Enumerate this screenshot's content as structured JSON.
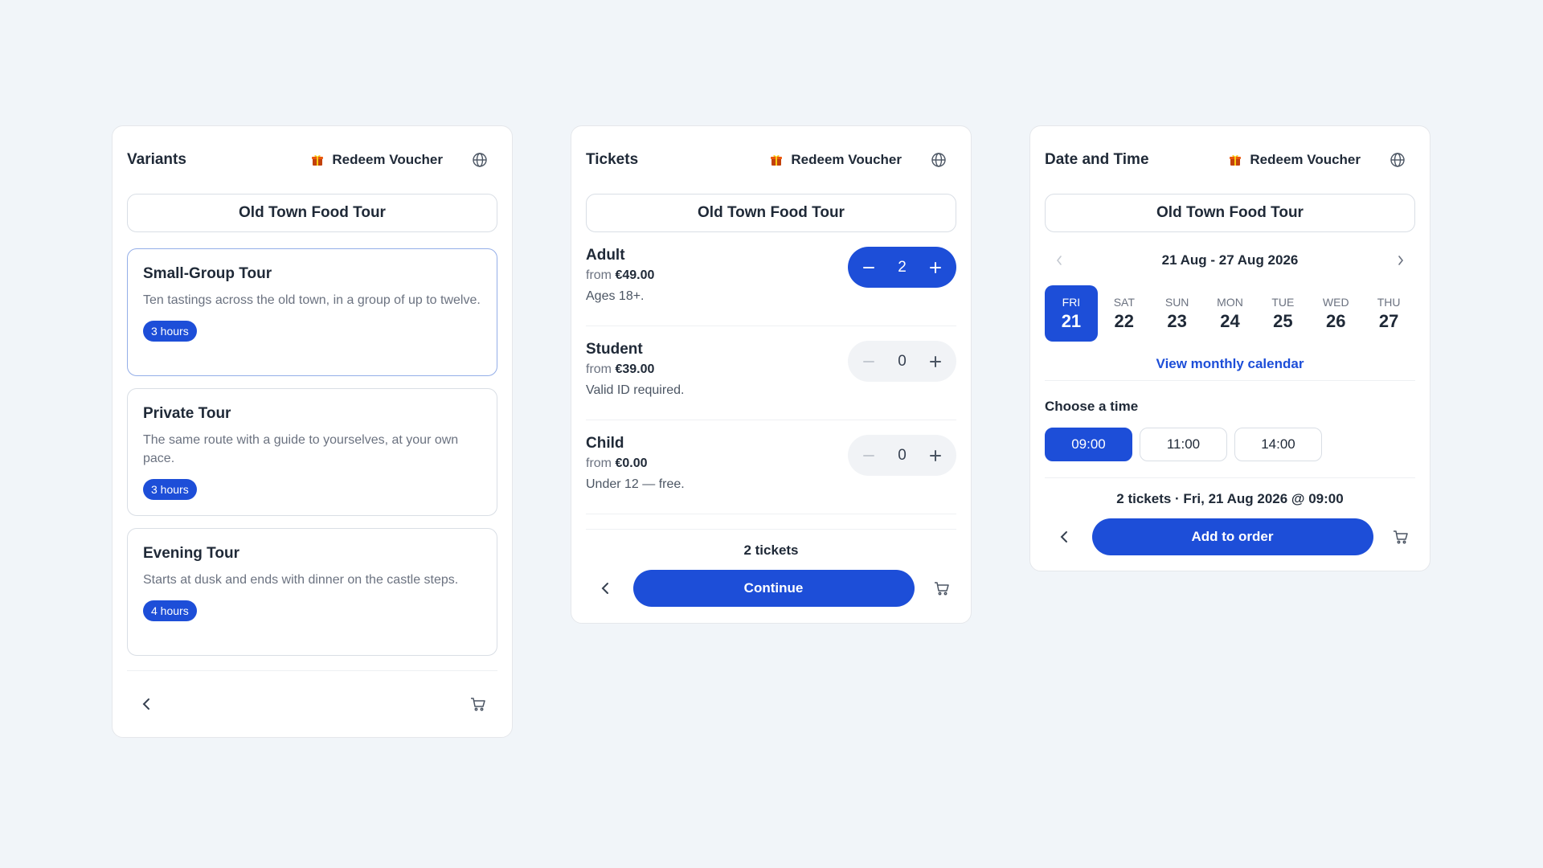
{
  "colors": {
    "accent": "#1d4ed8",
    "background": "#f1f5f9"
  },
  "voucher_label": "Redeem Voucher",
  "product_name": "Old Town Food Tour",
  "variants_panel": {
    "title": "Variants",
    "items": [
      {
        "title": "Small-Group Tour",
        "description": "Ten tastings across the old town, in a group of up to twelve.",
        "duration": "3 hours",
        "selected": true
      },
      {
        "title": "Private Tour",
        "description": "The same route with a guide to yourselves, at your own pace.",
        "duration": "3 hours",
        "selected": false
      },
      {
        "title": "Evening Tour",
        "description": "Starts at dusk and ends with dinner on the castle steps.",
        "duration": "4 hours",
        "selected": false
      }
    ]
  },
  "tickets_panel": {
    "title": "Tickets",
    "rows": [
      {
        "name": "Adult",
        "from_label": "from",
        "price": "€49.00",
        "note": "Ages 18+.",
        "count": "2"
      },
      {
        "name": "Student",
        "from_label": "from",
        "price": "€39.00",
        "note": "Valid ID required.",
        "count": "0"
      },
      {
        "name": "Child",
        "from_label": "from",
        "price": "€0.00",
        "note": "Under 12 — free.",
        "count": "0"
      }
    ],
    "summary": "2 tickets",
    "continue_label": "Continue"
  },
  "date_panel": {
    "title": "Date and Time",
    "week_range": "21 Aug - 27 Aug 2026",
    "days": [
      {
        "name": "FRI",
        "num": "21",
        "selected": true
      },
      {
        "name": "SAT",
        "num": "22"
      },
      {
        "name": "SUN",
        "num": "23"
      },
      {
        "name": "MON",
        "num": "24"
      },
      {
        "name": "TUE",
        "num": "25"
      },
      {
        "name": "WED",
        "num": "26"
      },
      {
        "name": "THU",
        "num": "27"
      }
    ],
    "monthly_link": "View monthly calendar",
    "choose_time_label": "Choose a time",
    "times": [
      {
        "label": "09:00",
        "selected": true
      },
      {
        "label": "11:00"
      },
      {
        "label": "14:00"
      }
    ],
    "summary": "2 tickets · Fri, 21 Aug 2026 @ 09:00",
    "add_label": "Add to order"
  }
}
